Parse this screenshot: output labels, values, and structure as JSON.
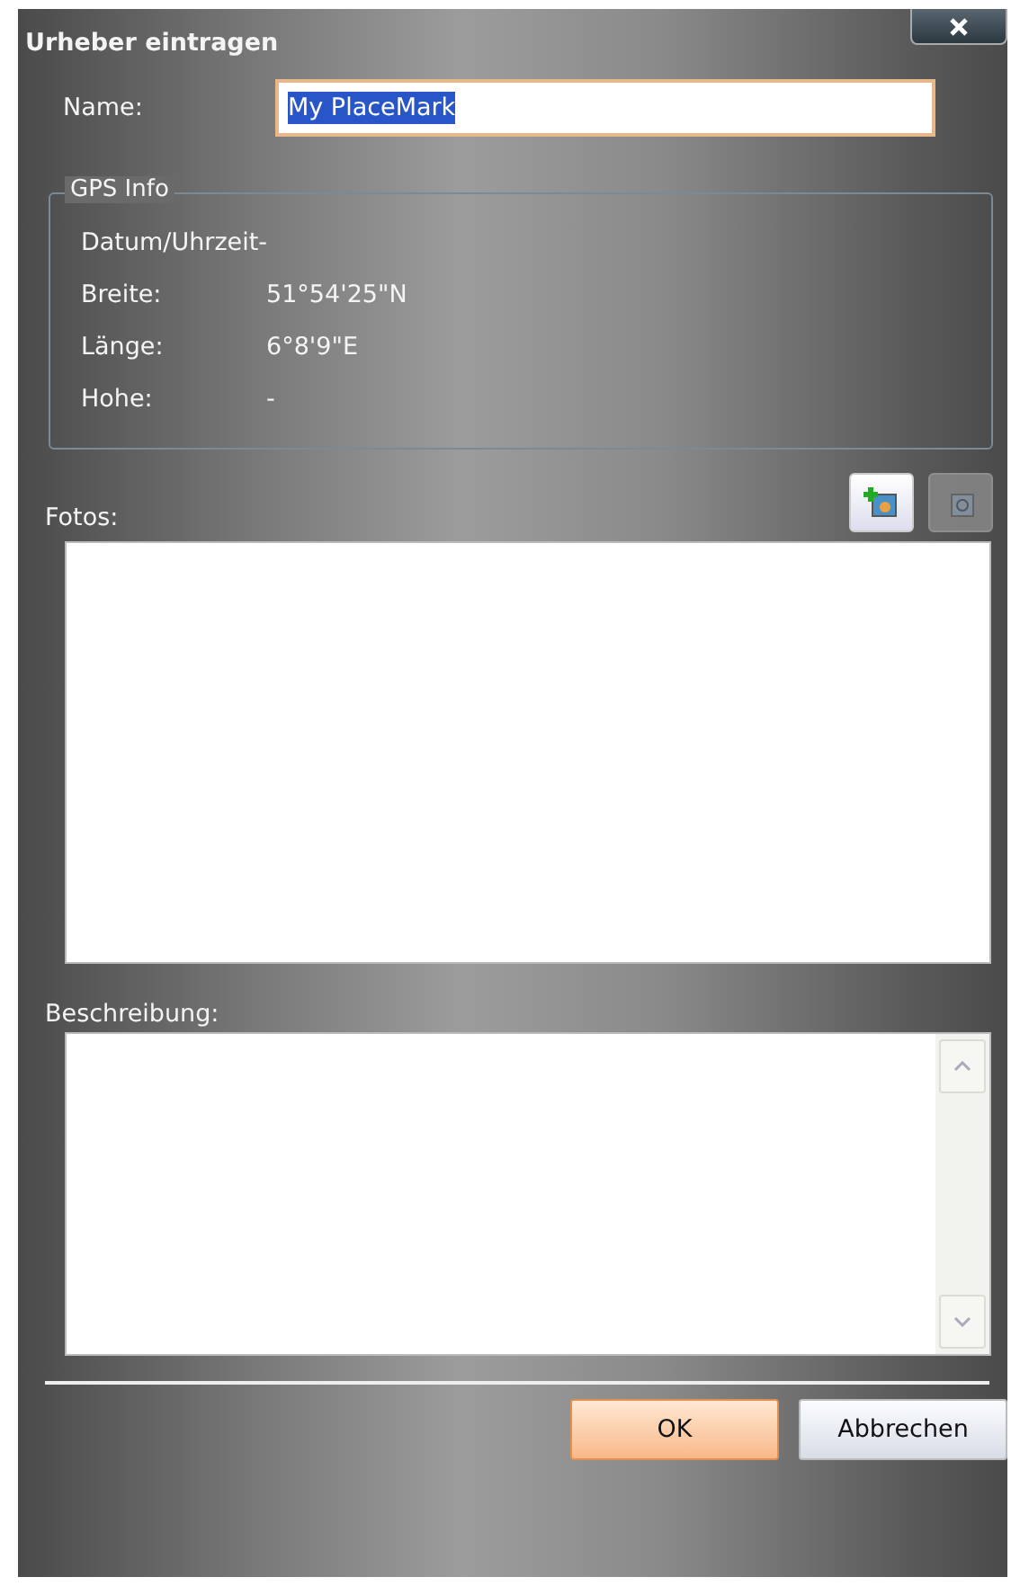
{
  "window": {
    "title": "Urheber eintragen"
  },
  "name": {
    "label": "Name:",
    "value": "My PlaceMark",
    "selected": true
  },
  "gps": {
    "legend": "GPS Info",
    "rows": [
      {
        "label": "Datum/Uhrzeit-",
        "value": null
      },
      {
        "label": "Breite:",
        "value": "51°54'25\"N"
      },
      {
        "label": "Länge:",
        "value": "6°8'9\"E"
      },
      {
        "label": "Hohe:",
        "value": "-"
      }
    ]
  },
  "photos": {
    "label": "Fotos:",
    "buttons": [
      {
        "kind": "add",
        "disabled": false
      },
      {
        "kind": "remove",
        "disabled": true
      }
    ]
  },
  "description": {
    "label": "Beschreibung:"
  },
  "buttons": [
    {
      "label": "OK",
      "default": true
    },
    {
      "label": "Abbrechen",
      "default": false
    }
  ]
}
